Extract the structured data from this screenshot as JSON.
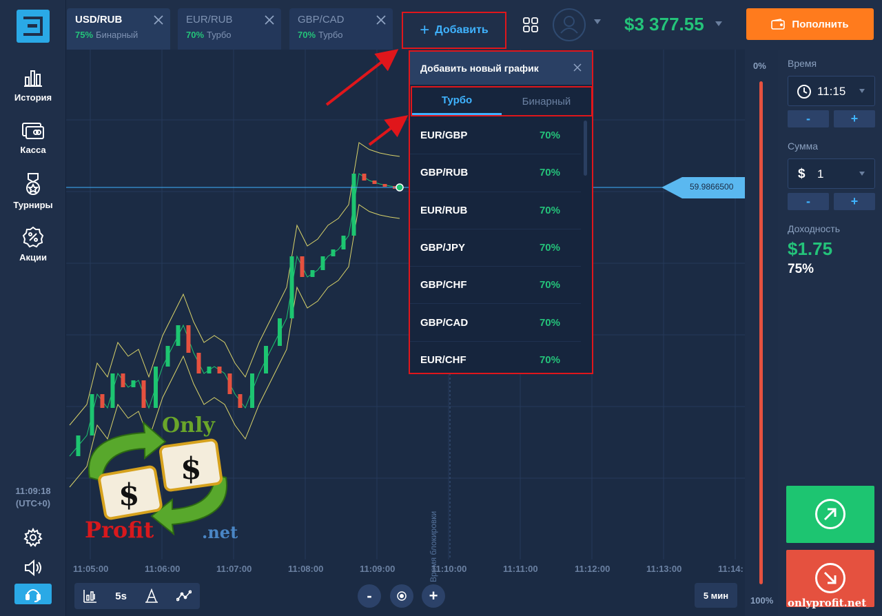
{
  "sidebar": {
    "items": [
      {
        "label": "История",
        "icon": "chart-bars-icon"
      },
      {
        "label": "Касса",
        "icon": "wallet-card-icon"
      },
      {
        "label": "Турниры",
        "icon": "medal-icon"
      },
      {
        "label": "Акции",
        "icon": "percent-badge-icon"
      }
    ],
    "clock": "11:09:18",
    "timezone": "(UTC+0)"
  },
  "tabs": [
    {
      "pair": "USD/RUB",
      "percent": "75%",
      "kind": "Бинарный",
      "active": true
    },
    {
      "pair": "EUR/RUB",
      "percent": "70%",
      "kind": "Турбо",
      "active": false
    },
    {
      "pair": "GBP/CAD",
      "percent": "70%",
      "kind": "Турбо",
      "active": false
    }
  ],
  "header": {
    "add_label": "Добавить",
    "balance": "$3 377.55",
    "deposit_label": "Пополнить"
  },
  "dropdown": {
    "title": "Добавить новый график",
    "tabs": [
      "Турбо",
      "Бинарный"
    ],
    "assets": [
      {
        "pair": "EUR/GBP",
        "percent": "70%"
      },
      {
        "pair": "GBP/RUB",
        "percent": "70%"
      },
      {
        "pair": "EUR/RUB",
        "percent": "70%"
      },
      {
        "pair": "GBP/JPY",
        "percent": "70%"
      },
      {
        "pair": "GBP/CHF",
        "percent": "70%"
      },
      {
        "pair": "GBP/CAD",
        "percent": "70%"
      },
      {
        "pair": "EUR/CHF",
        "percent": "70%"
      }
    ]
  },
  "chart": {
    "current_price": "59.9866500",
    "lock_label": "Время блокировки",
    "time_ticks": [
      "11:05:00",
      "11:06:00",
      "11:07:00",
      "11:08:00",
      "11:09:00",
      "11:10:00",
      "11:11:00",
      "11:12:00",
      "11:13:00",
      "11:14:"
    ],
    "timeframe": "5s",
    "interval": "5 мин",
    "zoom_out": "-",
    "zoom_in": "+"
  },
  "strip": {
    "top": "0%",
    "bottom": "100%"
  },
  "panel": {
    "time_label": "Время",
    "time_value": "11:15",
    "amount_label": "Сумма",
    "currency": "$",
    "amount_value": "1",
    "minus": "-",
    "plus": "+",
    "yield_label": "Доходность",
    "payout": "$1.75",
    "payout_pct": "75%"
  },
  "watermark": {
    "top_word": "Only",
    "bottom_word": "Profit",
    "suffix": ".net",
    "site": "onlyprofit.net"
  },
  "colors": {
    "accent": "#2aa9e6",
    "green": "#24c37a",
    "red": "#e5513f",
    "orange": "#ff7b1d",
    "annotation": "#e0161b"
  }
}
